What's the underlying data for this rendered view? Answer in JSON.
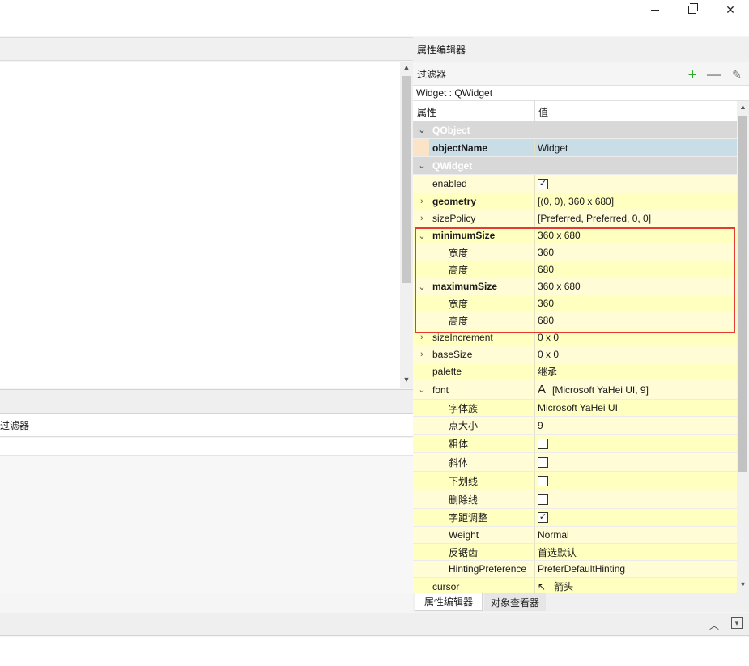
{
  "window": {
    "minimize_icon": "minimize-icon",
    "restore_icon": "restore-icon",
    "close_icon": "close-icon",
    "close_glyph": "✕"
  },
  "left": {
    "filter_label": "过滤器"
  },
  "property_editor": {
    "title": "属性编辑器",
    "filter_label": "过滤器",
    "add_glyph": "+",
    "remove_glyph": "—",
    "configure_glyph": "✎",
    "class_line": "Widget : QWidget",
    "col_property": "属性",
    "col_value": "值",
    "rows": [
      {
        "type": "category",
        "expander": "⌄",
        "name": "QObject"
      },
      {
        "type": "selected",
        "expander": "",
        "name": "objectName",
        "value": "Widget",
        "bold": true
      },
      {
        "type": "category",
        "expander": "⌄",
        "name": "QWidget"
      },
      {
        "type": "prop",
        "expander": "",
        "name": "enabled",
        "check": "✓"
      },
      {
        "type": "prop",
        "expander": "›",
        "name": "geometry",
        "value": "[(0, 0), 360 x 680]",
        "bold": true
      },
      {
        "type": "prop",
        "expander": "›",
        "name": "sizePolicy",
        "value": "[Preferred, Preferred, 0, 0]"
      },
      {
        "type": "prop",
        "expander": "⌄",
        "name": "minimumSize",
        "value": "360 x 680",
        "bold": true
      },
      {
        "type": "sub",
        "name": "宽度",
        "value": "360"
      },
      {
        "type": "sub",
        "name": "高度",
        "value": "680"
      },
      {
        "type": "prop",
        "expander": "⌄",
        "name": "maximumSize",
        "value": "360 x 680",
        "bold": true
      },
      {
        "type": "sub",
        "name": "宽度",
        "value": "360"
      },
      {
        "type": "sub",
        "name": "高度",
        "value": "680"
      },
      {
        "type": "prop",
        "expander": "›",
        "name": "sizeIncrement",
        "value": "0 x 0"
      },
      {
        "type": "prop",
        "expander": "›",
        "name": "baseSize",
        "value": "0 x 0"
      },
      {
        "type": "prop",
        "expander": "",
        "name": "palette",
        "value": "继承"
      },
      {
        "type": "prop",
        "expander": "⌄",
        "name": "font",
        "value": "[Microsoft YaHei UI, 9]",
        "font_glyph": "A"
      },
      {
        "type": "sub",
        "name": "字体族",
        "value": "Microsoft YaHei UI"
      },
      {
        "type": "sub",
        "name": "点大小",
        "value": "9"
      },
      {
        "type": "sub",
        "name": "粗体",
        "check": ""
      },
      {
        "type": "sub",
        "name": "斜体",
        "check": ""
      },
      {
        "type": "sub",
        "name": "下划线",
        "check": ""
      },
      {
        "type": "sub",
        "name": "删除线",
        "check": ""
      },
      {
        "type": "sub",
        "name": "字距调整",
        "check": "✓"
      },
      {
        "type": "sub",
        "name": "Weight",
        "value": "Normal"
      },
      {
        "type": "sub",
        "name": "反锯齿",
        "value": "首选默认"
      },
      {
        "type": "sub",
        "name": "HintingPreference",
        "value": "PreferDefaultHinting"
      },
      {
        "type": "prop",
        "expander": "",
        "name": "cursor",
        "value": "箭头",
        "cursor_glyph": "↖"
      }
    ]
  },
  "tabs": {
    "active": "属性编辑器",
    "inactive": "对象查看器"
  },
  "bottom": {
    "collapse_glyph": "︿",
    "dock_glyph": "▾"
  },
  "scroll": {
    "up": "▲",
    "down": "▼"
  }
}
